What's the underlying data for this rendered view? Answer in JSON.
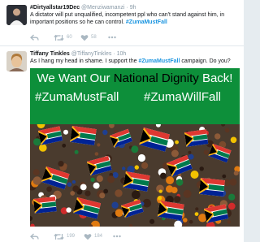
{
  "tweets": [
    {
      "name": "#Dirtyallstar19Dec",
      "handle": "@Menziwamanzi",
      "separator": "·",
      "time": "9h",
      "text_before": "A dictator will put unqualified, incompetent ppl who can't stand against him, in important positions so he can control. ",
      "hashtag": "#ZumaMustFall",
      "text_after": "",
      "retweets": "60",
      "likes": "58",
      "avatar_icon": "avatar-icon"
    },
    {
      "name": "Tiffany Tinkles",
      "handle": "@TiffanyTinkles",
      "separator": "·",
      "time": "10h",
      "text_before": "As I hang my head in shame. I support the ",
      "hashtag": "#ZumaMustFall",
      "text_after": " campaign. Do you?",
      "retweets": "199",
      "likes": "184",
      "avatar_icon": "avatar-icon",
      "image": {
        "line1_start": "We Want Our ",
        "line1_em": "National Dignity",
        "line1_end": " Back!",
        "tag1": "#ZumaMustFall",
        "tag2": "#ZumaWillFall"
      }
    }
  ],
  "icons": {
    "reply": "reply-icon",
    "retweet": "retweet-icon",
    "like": "heart-icon",
    "more": "more-icon"
  },
  "colors": {
    "hashtag": "#1b95e0",
    "banner_green": "#0d8f3a",
    "icon_gray": "#aab8c2"
  }
}
